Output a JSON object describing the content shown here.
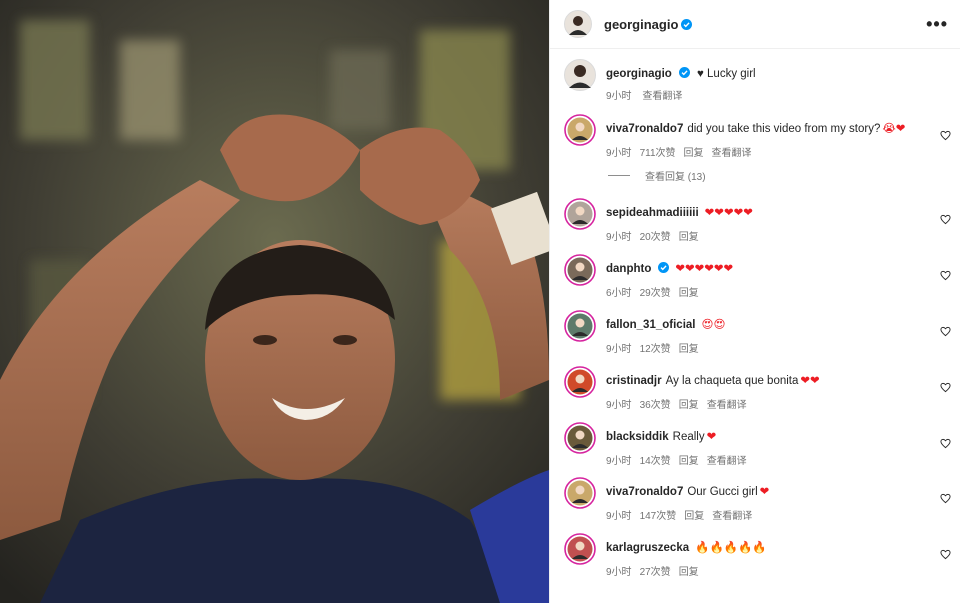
{
  "header": {
    "username": "georginagio",
    "more_label": "•••"
  },
  "caption": {
    "username": "georginagio",
    "text": "♥ Lucky girl",
    "time": "9小时",
    "translate": "查看翻译"
  },
  "comments": [
    {
      "username": "viva7ronaldo7",
      "text": "did you take this video from my story?",
      "emoji": "😭❤",
      "time": "9小时",
      "likes": "711次赞",
      "reply": "回复",
      "translate": "查看翻译",
      "avatar_color": "#c9a86a"
    },
    {
      "username": "sepideahmadiiiiii",
      "text": "",
      "emoji": "❤❤❤❤❤",
      "time": "9小时",
      "likes": "20次赞",
      "reply": "回复",
      "translate": "",
      "avatar_color": "#b0a49a"
    },
    {
      "username": "danphto",
      "text": "",
      "emoji": "❤❤❤❤❤❤",
      "time": "6小时",
      "likes": "29次赞",
      "reply": "回复",
      "translate": "",
      "avatar_color": "#7a6a5a"
    },
    {
      "username": "fallon_31_oficial",
      "text": "",
      "emoji": "😍😍",
      "time": "9小时",
      "likes": "12次赞",
      "reply": "回复",
      "translate": "",
      "avatar_color": "#5d7a6a"
    },
    {
      "username": "cristinadjr",
      "text": "Ay la chaqueta que bonita",
      "emoji": "❤❤",
      "time": "9小时",
      "likes": "36次赞",
      "reply": "回复",
      "translate": "查看翻译",
      "avatar_color": "#d04a2a"
    },
    {
      "username": "blacksiddik",
      "text": "Really",
      "emoji": "❤",
      "time": "9小时",
      "likes": "14次赞",
      "reply": "回复",
      "translate": "查看翻译",
      "avatar_color": "#6a5a3a"
    },
    {
      "username": "viva7ronaldo7",
      "text": "Our Gucci girl",
      "emoji": "❤",
      "time": "9小时",
      "likes": "147次赞",
      "reply": "回复",
      "translate": "查看翻译",
      "avatar_color": "#c9a86a"
    },
    {
      "username": "karlagruszecka",
      "text": "",
      "emoji": "🔥🔥🔥🔥🔥",
      "time": "9小时",
      "likes": "27次赞",
      "reply": "回复",
      "translate": "",
      "avatar_color": "#c05050"
    }
  ],
  "view_replies": "查看回复 (13)",
  "colors": {
    "accent_red": "#ed1d24",
    "verified_blue": "#0095f6",
    "meta_gray": "#737373"
  }
}
